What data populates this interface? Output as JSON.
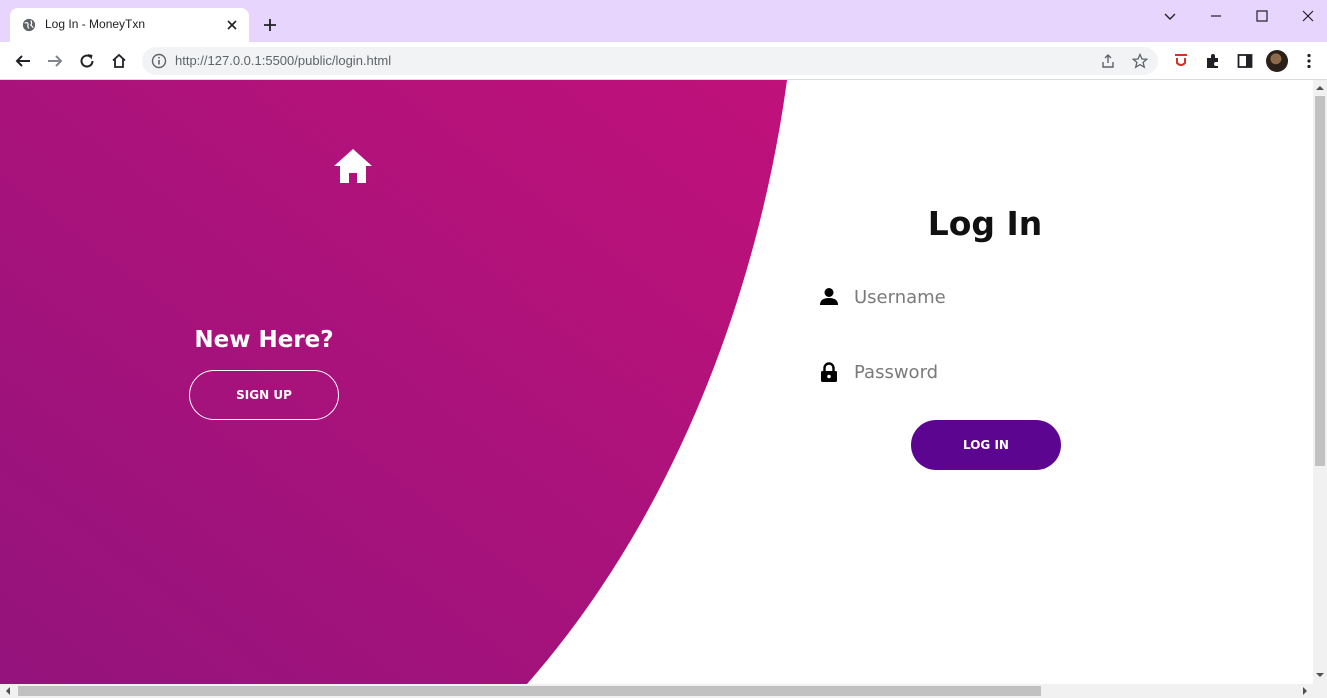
{
  "browser": {
    "tab_title": "Log In - MoneyTxn",
    "url": "http://127.0.0.1:5500/public/login.html"
  },
  "left_panel": {
    "heading": "New Here?",
    "signup_label": "SIGN UP",
    "gradient_colors": [
      "#c0117a",
      "#94137c"
    ]
  },
  "login_form": {
    "title": "Log In",
    "username_placeholder": "Username",
    "password_placeholder": "Password",
    "submit_label": "LOG IN",
    "accent_color": "#5c0591"
  },
  "icons": {
    "home": "home-icon",
    "user": "user-icon",
    "lock": "lock-icon"
  }
}
